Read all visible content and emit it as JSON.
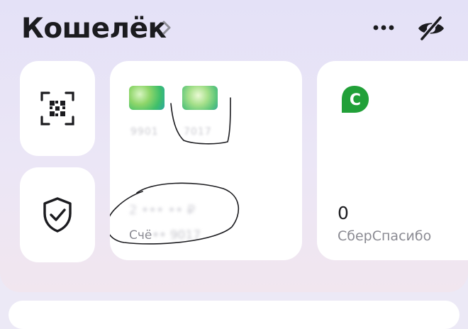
{
  "header": {
    "title": "Кошелёк"
  },
  "wallet_card": {
    "card1_number_masked": "9901",
    "card2_number_masked": "7017",
    "account_amount": "2 ••• •• ₽",
    "account_label_prefix": "Счё",
    "account_label_suffix": "•• 9017"
  },
  "spasibo": {
    "value": "0",
    "label": "СберСпасибо",
    "logo_letter": "С",
    "brand_color": "#21A038"
  },
  "icons": {
    "qr": "qr-scanner-icon",
    "shield": "shield-check-icon",
    "more": "more-horizontal-icon",
    "eye": "eye-slash-icon",
    "chevron": "chevron-right-icon"
  }
}
